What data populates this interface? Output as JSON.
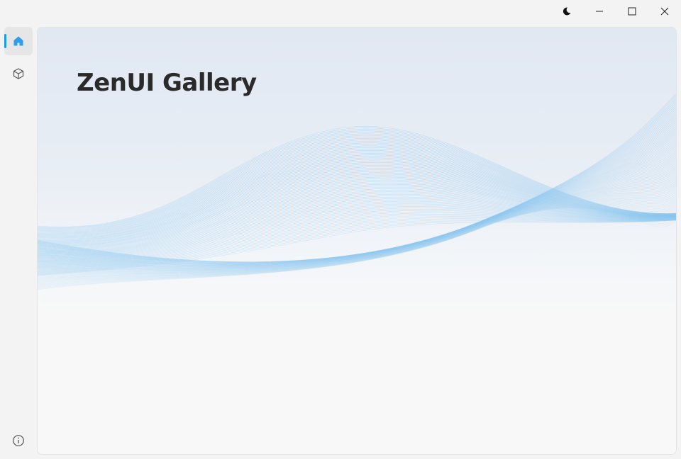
{
  "app": {
    "title": "ZenUI Gallery"
  },
  "titlebar": {
    "buttons": [
      {
        "icon": "moon-icon",
        "label": "theme"
      },
      {
        "icon": "minimize-icon",
        "label": "minimize"
      },
      {
        "icon": "maximize-icon",
        "label": "maximize"
      },
      {
        "icon": "close-icon",
        "label": "close"
      }
    ]
  },
  "sidebar": {
    "items": [
      {
        "icon": "home-icon",
        "selected": true
      },
      {
        "icon": "cube-icon",
        "selected": false
      },
      {
        "icon": "info-icon",
        "selected": false
      }
    ]
  },
  "colors": {
    "accent": "#1f9be0",
    "wave": "#7cc0ef",
    "title": "#2a2a2a"
  }
}
